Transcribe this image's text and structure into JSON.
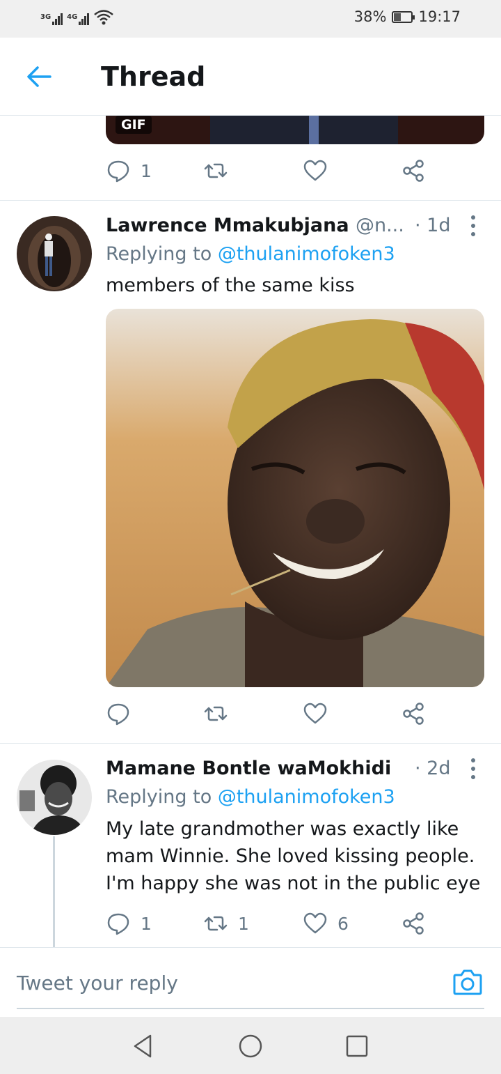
{
  "status_bar": {
    "network_1": "3G",
    "network_2": "4G",
    "battery_percent": "38%",
    "battery_level": 0.38,
    "time": "19:17"
  },
  "header": {
    "back_icon": "arrow-left-icon",
    "title": "Thread"
  },
  "top_tweet": {
    "media_badge": "GIF",
    "actions": {
      "reply_count": "1",
      "retweet_count": "",
      "like_count": ""
    }
  },
  "tweets": [
    {
      "author": "Lawrence Mmakubjana",
      "handle": "@n...",
      "time": "· 1d",
      "reply_prefix": "Replying to",
      "reply_to": "@thulanimofoken3",
      "text": "members of the same kiss",
      "has_photo": true,
      "actions": {
        "reply_count": "",
        "retweet_count": "",
        "like_count": ""
      }
    },
    {
      "author": "Mamane Bontle waMokhidi",
      "handle": "",
      "time": "· 2d",
      "reply_prefix": "Replying to",
      "reply_to": "@thulanimofoken3",
      "text": "My late grandmother was exactly like mam Winnie. She loved kissing people. I'm happy she was not in the public eye",
      "has_photo": false,
      "actions": {
        "reply_count": "1",
        "retweet_count": "1",
        "like_count": "6"
      }
    }
  ],
  "reply_bar": {
    "placeholder": "Tweet your reply",
    "camera_icon": "camera-icon"
  },
  "colors": {
    "accent": "#1da1f2",
    "text_primary": "#14171a",
    "text_secondary": "#657786",
    "divider": "#e1e8ed"
  }
}
